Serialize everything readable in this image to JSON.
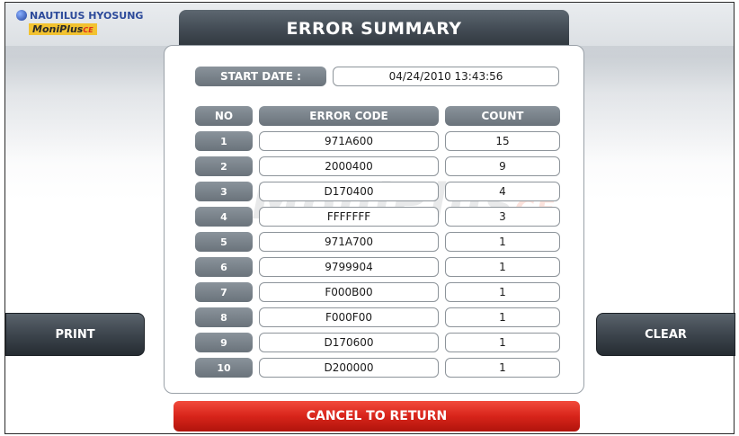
{
  "logo": {
    "brand": "NAUTILUS HYOSUNG",
    "product": "MoniPlus",
    "product_suffix": "CE"
  },
  "header": {
    "title": "ERROR SUMMARY"
  },
  "start_date": {
    "label": "START DATE :",
    "value": "04/24/2010 13:43:56"
  },
  "table": {
    "headers": {
      "no": "NO",
      "code": "ERROR CODE",
      "count": "COUNT"
    },
    "rows": [
      {
        "no": "1",
        "code": "971A600",
        "count": "15"
      },
      {
        "no": "2",
        "code": "2000400",
        "count": "9"
      },
      {
        "no": "3",
        "code": "D170400",
        "count": "4"
      },
      {
        "no": "4",
        "code": "FFFFFFF",
        "count": "3"
      },
      {
        "no": "5",
        "code": "971A700",
        "count": "1"
      },
      {
        "no": "6",
        "code": "9799904",
        "count": "1"
      },
      {
        "no": "7",
        "code": "F000B00",
        "count": "1"
      },
      {
        "no": "8",
        "code": "F000F00",
        "count": "1"
      },
      {
        "no": "9",
        "code": "D170600",
        "count": "1"
      },
      {
        "no": "10",
        "code": "D200000",
        "count": "1"
      }
    ]
  },
  "buttons": {
    "print": "PRINT",
    "clear": "CLEAR",
    "cancel": "CANCEL TO RETURN"
  },
  "colors": {
    "header_bg": "#434c55",
    "pill_bg": "#7a838b",
    "cancel_bg": "#d8241a",
    "brand_blue": "#2c4a9a",
    "product_yellow": "#f2c230"
  }
}
